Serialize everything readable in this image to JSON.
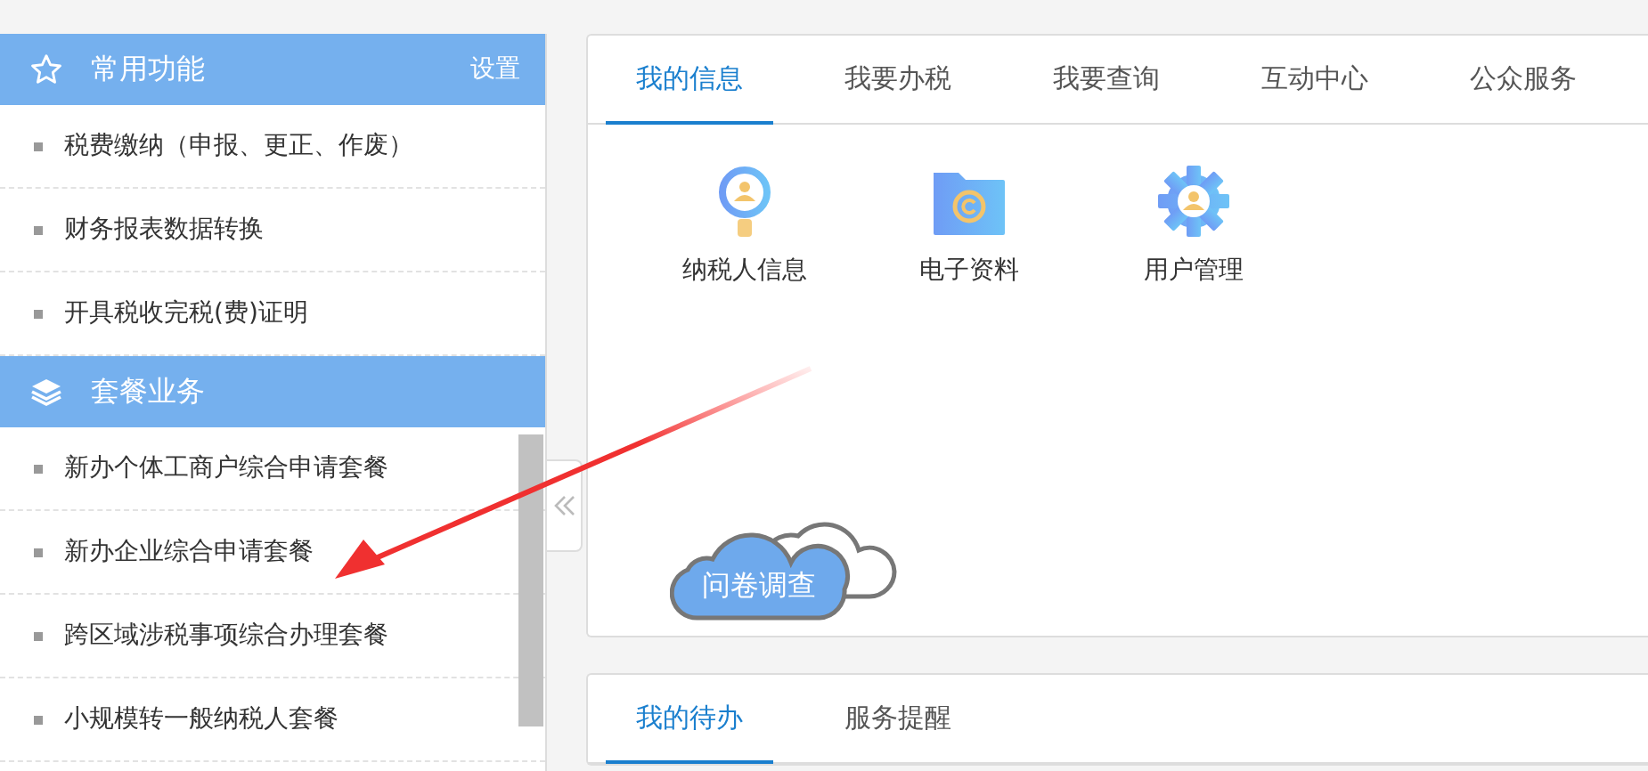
{
  "sidebar": {
    "sections": [
      {
        "title": "常用功能",
        "kind": "star",
        "action": "设置",
        "items": [
          "税费缴纳（申报、更正、作废）",
          "财务报表数据转换",
          "开具税收完税(费)证明"
        ]
      },
      {
        "title": "套餐业务",
        "kind": "layers",
        "items": [
          "新办个体工商户综合申请套餐",
          "新办企业综合申请套餐",
          "跨区域涉税事项综合办理套餐",
          "小规模转一般纳税人套餐"
        ]
      }
    ]
  },
  "main": {
    "tabs": [
      {
        "label": "我的信息",
        "selected": true
      },
      {
        "label": "我要办税",
        "selected": false
      },
      {
        "label": "我要查询",
        "selected": false
      },
      {
        "label": "互动中心",
        "selected": false
      },
      {
        "label": "公众服务",
        "selected": false
      }
    ],
    "shortcuts": [
      {
        "label": "纳税人信息",
        "kind": "person-search"
      },
      {
        "label": "电子资料",
        "kind": "folder"
      },
      {
        "label": "用户管理",
        "kind": "gear"
      }
    ],
    "survey": "问卷调查"
  },
  "todo": {
    "tabs": [
      {
        "label": "我的待办",
        "selected": true
      },
      {
        "label": "服务提醒",
        "selected": false
      }
    ]
  }
}
